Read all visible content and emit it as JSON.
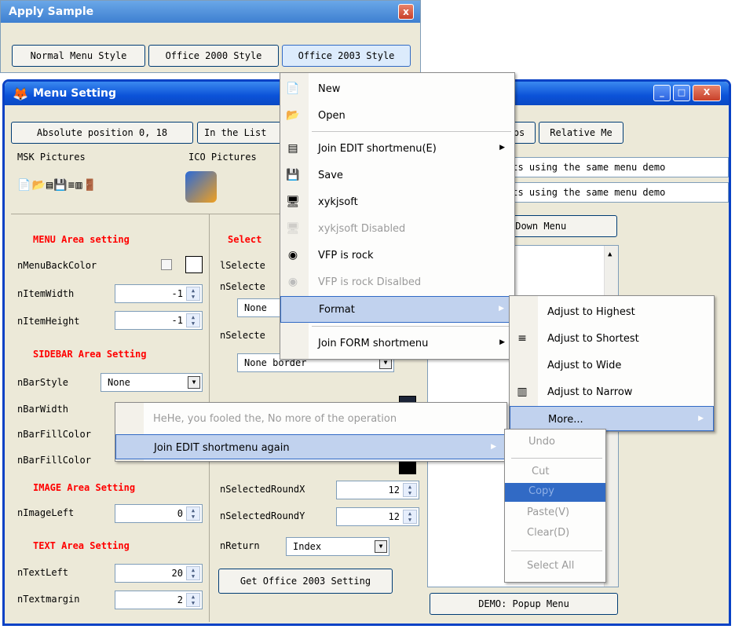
{
  "apply_window": {
    "title": "Apply Sample",
    "close": "x",
    "buttons": [
      "Normal Menu Style",
      "Office 2000 Style",
      "Office 2003 Style"
    ]
  },
  "main_window": {
    "title": "Menu Setting",
    "top_buttons": [
      "Absolute position 0, 18",
      "In the List",
      "ps",
      "Relative Me"
    ],
    "msk_label": "MSK Pictures",
    "ico_label": "ICO Pictures",
    "text_rows": [
      "cts using the same menu demo",
      "cts using the same menu demo"
    ],
    "popdown_button": "pDown Menu",
    "demo_popup_button": "DEMO: Popup Menu",
    "left_panel": {
      "menu_area": "MENU Area setting",
      "nMenuBackColor": "nMenuBackColor",
      "nItemWidth": "nItemWidth",
      "nItemWidth_val": "-1",
      "nItemHeight": "nItemHeight",
      "nItemHeight_val": "-1",
      "sidebar_area": "SIDEBAR Area Setting",
      "nBarStyle": "nBarStyle",
      "nBarStyle_val": "None",
      "nBarWidth": "nBarWidth",
      "nBarFillColor1": "nBarFillColor",
      "nBarFillColor2": "nBarFillColor",
      "image_area": "IMAGE Area Setting",
      "nImageLeft": "nImageLeft",
      "nImageLeft_val": "0",
      "text_area": "TEXT Area Setting",
      "nTextLeft": "nTextLeft",
      "nTextLeft_val": "20",
      "nTextmargin": "nTextmargin",
      "nTextmargin_val": "2"
    },
    "mid_panel": {
      "select_area": "Select",
      "lSelected": "lSelecte",
      "nSelected1": "nSelecte",
      "none1": "None",
      "nSelected2": "nSelecte",
      "none_border": "None border",
      "nSelectedRoundX": "nSelectedRoundX",
      "roundx_val": "12",
      "nSelectedRoundY": "nSelectedRoundY",
      "roundy_val": "12",
      "nReturn": "nReturn",
      "nReturn_val": "Index",
      "get_button": "Get Office 2003 Setting"
    }
  },
  "menu1": {
    "items": [
      {
        "label": "New",
        "icon": "new-doc-icon"
      },
      {
        "label": "Open",
        "icon": "folder-icon"
      },
      {
        "label": "Join EDIT shortmenu(E)",
        "icon": "textbox-icon"
      },
      {
        "label": "Save",
        "icon": "floppy-icon"
      },
      {
        "label": "xykjsoft",
        "icon": "app-icon"
      },
      {
        "label": "xykjsoft Disabled",
        "icon": "app-icon"
      },
      {
        "label": "VFP is rock",
        "icon": "fox-icon"
      },
      {
        "label": "VFP is rock Disalbed",
        "icon": "fox-icon"
      },
      {
        "label": "Format",
        "icon": ""
      },
      {
        "label": "Join FORM shortmenu",
        "icon": ""
      }
    ]
  },
  "menu2": {
    "items": [
      "Adjust to Highest",
      "Adjust to Shortest",
      "Adjust to Wide",
      "Adjust to Narrow",
      "More..."
    ]
  },
  "menu3": {
    "items": [
      "HeHe, you fooled the, No more of the operation",
      "Join EDIT shortmenu again"
    ]
  },
  "menu4": {
    "items": [
      "Undo",
      "Cut",
      "Copy",
      "Paste(V)",
      "Clear(D)",
      "Select All"
    ]
  }
}
